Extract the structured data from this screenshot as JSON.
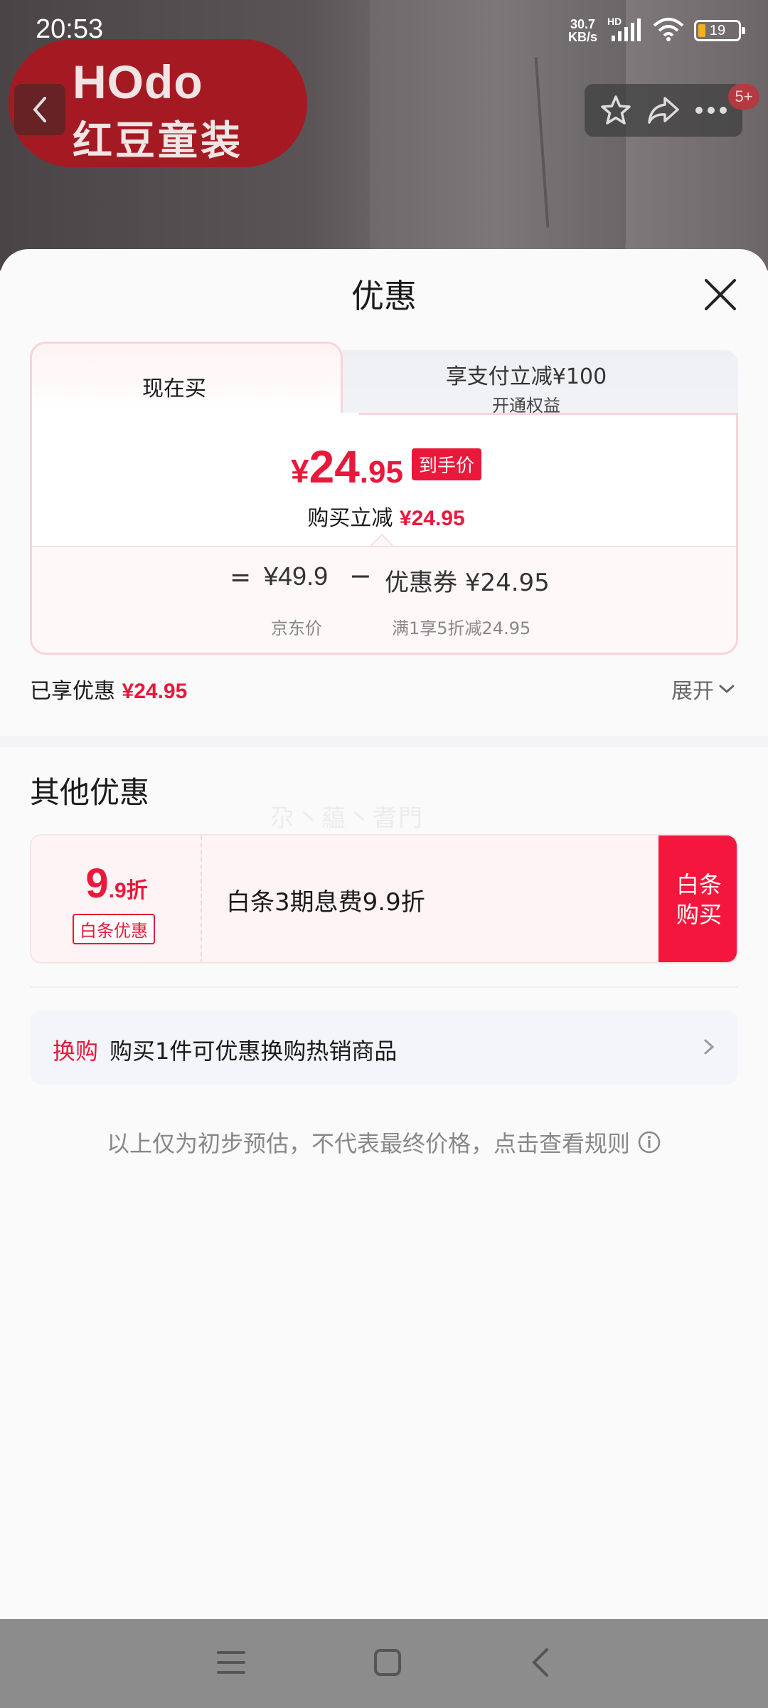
{
  "status_bar": {
    "time": "20:53",
    "net_speed_value": "30.7",
    "net_speed_unit": "KB/s",
    "hd": "HD",
    "battery": "19"
  },
  "brand": {
    "logo_latin": "HOdo",
    "logo_chinese": "红豆童装"
  },
  "header": {
    "badge": "5+"
  },
  "sheet": {
    "title": "优惠",
    "tabs": [
      {
        "label": "现在买"
      },
      {
        "label": "享支付立减¥100",
        "sub": "开通权益"
      }
    ],
    "price": {
      "symbol": "¥",
      "integer": "24",
      "decimal": ".95",
      "tag": "到手价"
    },
    "reduce": {
      "label": "购买立减",
      "value": "¥24.95"
    },
    "calc": {
      "equals": "=",
      "jd_price": "¥49.9",
      "minus": "−",
      "coupon": "优惠券 ¥24.95",
      "jd_label": "京东价",
      "coupon_label": "满1享5折减24.95"
    },
    "enjoyed": {
      "label": "已享优惠",
      "value": "¥24.95"
    },
    "expand": "展开",
    "other_title": "其他优惠",
    "watermark": "尕丶藴丶耆門",
    "promo": {
      "rate_big": "9",
      "rate_small": ".9折",
      "tag": "白条优惠",
      "text": "白条3期息费9.9折",
      "button_line1": "白条",
      "button_line2": "购买"
    },
    "exchange": {
      "tag": "换购",
      "text": "购买1件可优惠换购热销商品"
    },
    "disclaimer": "以上仅为初步预估，不代表最终价格，点击查看规则"
  },
  "colors": {
    "accent": "#e8193b",
    "promo_button": "#f5163d",
    "card_border": "#f9d4da"
  },
  "icons": [
    "back-arrow-icon",
    "star-icon",
    "share-icon",
    "more-icon",
    "close-icon",
    "chevron-down-icon",
    "chevron-right-icon",
    "info-icon",
    "menu-icon",
    "home-icon",
    "back-icon",
    "signal-icon",
    "wifi-icon",
    "battery-icon"
  ]
}
